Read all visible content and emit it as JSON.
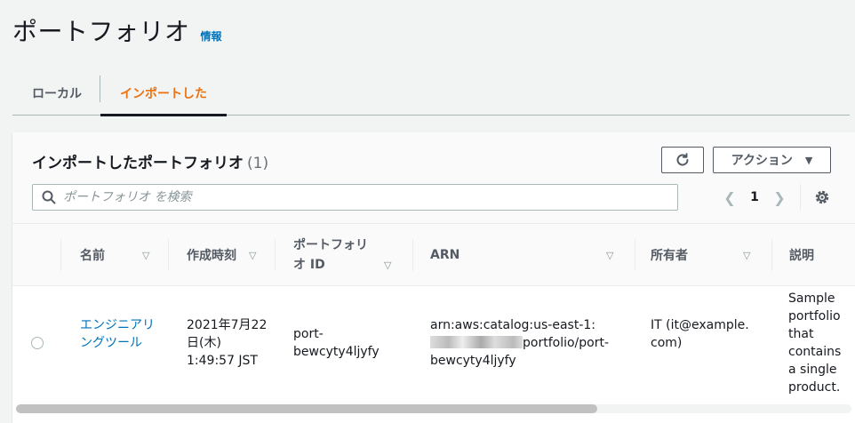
{
  "page": {
    "title": "ポートフォリオ",
    "info_link": "情報"
  },
  "tabs": [
    {
      "label": "ローカル",
      "active": false
    },
    {
      "label": "インポートした",
      "active": true
    }
  ],
  "panel": {
    "title": "インポートしたポートフォリオ",
    "count": "(1)",
    "actions_label": "アクション",
    "search_placeholder": "ポートフォリオ を検索",
    "current_page": "1"
  },
  "table": {
    "columns": [
      "名前",
      "作成時刻",
      "ポートフォリオ ID",
      "ARN",
      "所有者",
      "説明"
    ],
    "rows": [
      {
        "name": "エンジニアリングツール",
        "created": "2021年7月22日(木) 1:49:57 JST",
        "portfolio_id": "port-bewcyty4ljyfy",
        "arn_prefix": "arn:aws:catalog:us-east-1:",
        "arn_suffix": "portfolio/port-bewcyty4ljyfy",
        "owner": "IT (it@example.com)",
        "description": "Sample portfolio that contains a single product."
      }
    ]
  },
  "colors": {
    "accent": "#ec7211",
    "link": "#0073bb",
    "text": "#16191f",
    "muted": "#545b64",
    "border": "#aab7b8"
  },
  "icons": [
    "refresh-icon",
    "caret-down-icon",
    "search-icon",
    "chevron-left-icon",
    "chevron-right-icon",
    "gear-icon",
    "sort-icon"
  ]
}
